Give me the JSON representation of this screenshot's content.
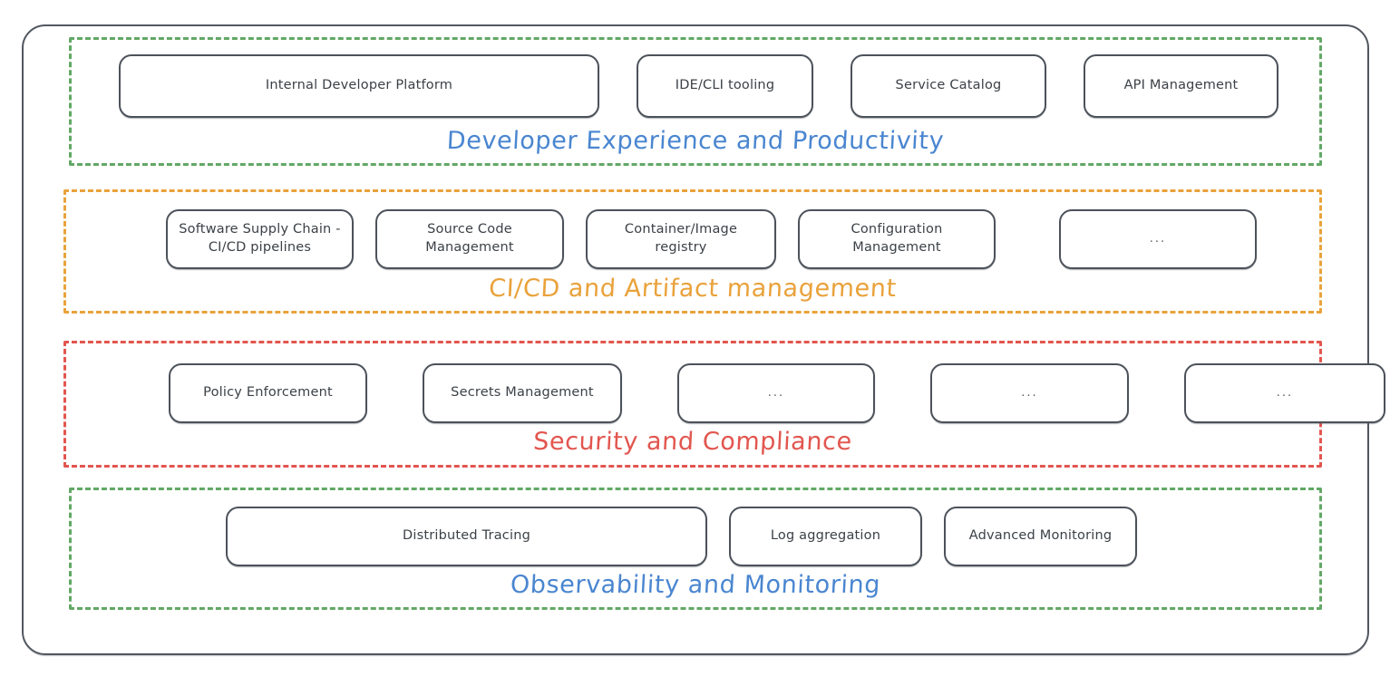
{
  "diagram": {
    "title_visible": false,
    "style": "hand-drawn-sketch",
    "colors": {
      "frame": "#515760",
      "node_border": "#4c525a",
      "node_text": "#3c4147",
      "green": "#62a866",
      "orange": "#e9a23b",
      "red": "#e2564f",
      "blue_label": "#4a86d0"
    },
    "sections": [
      {
        "id": "developer-experience",
        "label": "Developer Experience and Productivity",
        "label_color": "#4a86d0",
        "border_color": "#62a866",
        "nodes": [
          {
            "label": "Internal Developer Platform"
          },
          {
            "label": "IDE/CLI tooling"
          },
          {
            "label": "Service Catalog"
          },
          {
            "label": "API Management"
          }
        ]
      },
      {
        "id": "cicd-artifact-management",
        "label": "CI/CD and Artifact management",
        "label_color": "#e9a23b",
        "border_color": "#e9a23b",
        "nodes": [
          {
            "label": "Software Supply Chain -\nCI/CD pipelines"
          },
          {
            "label": "Source Code Management"
          },
          {
            "label": "Container/Image registry"
          },
          {
            "label": "Configuration Management"
          },
          {
            "label": "..."
          }
        ]
      },
      {
        "id": "security-compliance",
        "label": "Security and Compliance",
        "label_color": "#e2564f",
        "border_color": "#e2564f",
        "nodes": [
          {
            "label": "Policy Enforcement"
          },
          {
            "label": "Secrets Management"
          },
          {
            "label": "..."
          },
          {
            "label": "..."
          },
          {
            "label": "..."
          }
        ]
      },
      {
        "id": "observability-monitoring",
        "label": "Observability and Monitoring",
        "label_color": "#4a86d0",
        "border_color": "#62a866",
        "nodes": [
          {
            "label": "Distributed Tracing"
          },
          {
            "label": "Log aggregation"
          },
          {
            "label": "Advanced Monitoring"
          }
        ]
      }
    ]
  }
}
